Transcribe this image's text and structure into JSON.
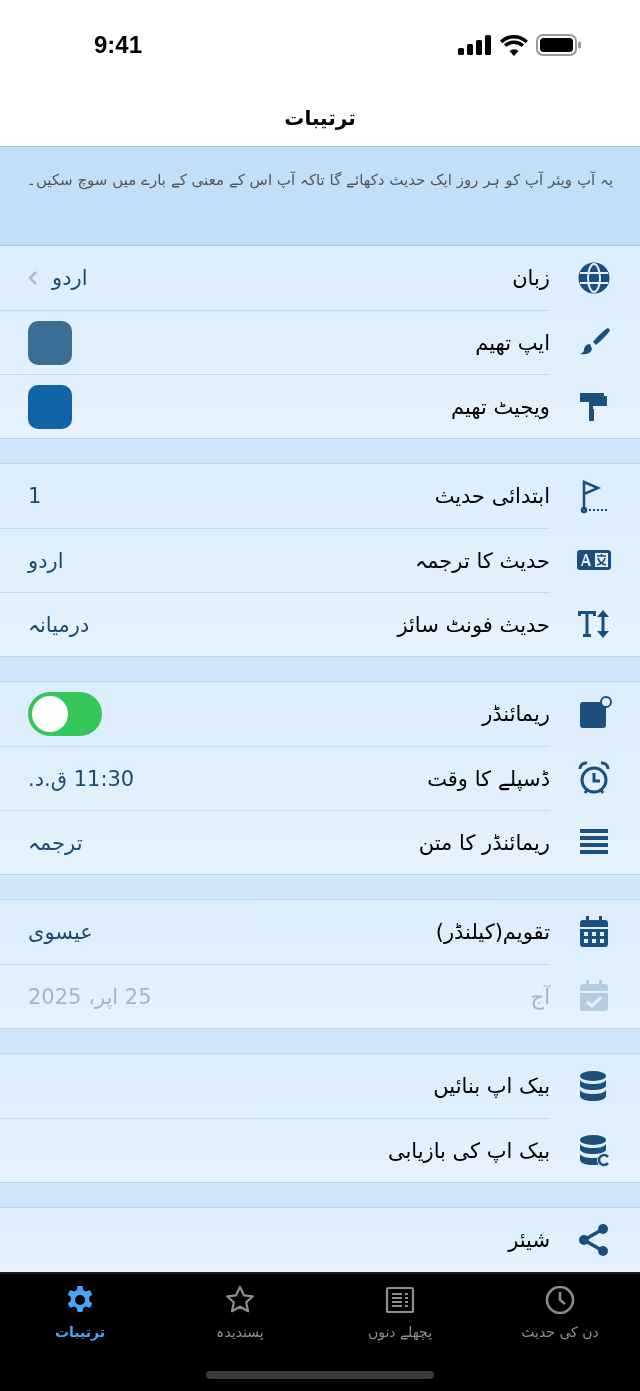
{
  "status_bar": {
    "time": "9:41"
  },
  "nav": {
    "title": "ترتیبات"
  },
  "banner": {
    "text": "یہ آپ ویئر آپ کو ہر روز ایک حدیث دکھائے گا تاکہ آپ اس کے معنی کے بارے میں سوچ سکیں۔"
  },
  "sections": [
    {
      "rows": [
        {
          "kind": "value",
          "label": "زبان",
          "value": "اردو",
          "chevron": true,
          "disabled": false
        },
        {
          "kind": "swatch",
          "label": "ایپ تھیم",
          "color": "#3a6e95",
          "disabled": false
        },
        {
          "kind": "swatch",
          "label": "ویجیٹ تھیم",
          "color": "#0f63a6",
          "disabled": false
        }
      ]
    },
    {
      "rows": [
        {
          "kind": "value",
          "label": "ابتدائی حدیث",
          "value": "1",
          "chevron": false,
          "disabled": false
        },
        {
          "kind": "value",
          "label": "حدیث کا ترجمہ",
          "value": "اردو",
          "chevron": false,
          "disabled": false
        },
        {
          "kind": "value",
          "label": "حدیث فونٹ سائز",
          "value": "درمیانہ",
          "chevron": false,
          "disabled": false
        }
      ]
    },
    {
      "rows": [
        {
          "kind": "toggle",
          "label": "ریمائنڈر",
          "on": true,
          "disabled": false
        },
        {
          "kind": "value",
          "label": "ڈسپلے کا وقت",
          "value": "11:30 ق.د.",
          "chevron": false,
          "disabled": false
        },
        {
          "kind": "value",
          "label": "ریمائنڈر کا متن",
          "value": "ترجمہ",
          "chevron": false,
          "disabled": false
        }
      ]
    },
    {
      "rows": [
        {
          "kind": "value",
          "label": "تقویم(کیلنڈر)",
          "value": "عیسوی",
          "chevron": false,
          "disabled": false
        },
        {
          "kind": "value",
          "label": "آج",
          "value": "25 اپر، 2025",
          "chevron": false,
          "disabled": true
        }
      ]
    },
    {
      "rows": [
        {
          "kind": "plain",
          "label": "بیک اپ بنائیں",
          "disabled": false
        },
        {
          "kind": "plain",
          "label": "بیک اپ کی بازیابی",
          "disabled": false
        }
      ]
    },
    {
      "rows": [
        {
          "kind": "plain",
          "label": "شیئر",
          "disabled": false
        }
      ]
    }
  ],
  "tab_bar": [
    {
      "label": "دن کی حدیث",
      "selected": false
    },
    {
      "label": "پچھلے دنوں",
      "selected": false
    },
    {
      "label": "پسندیدہ",
      "selected": false
    },
    {
      "label": "ترتیبات",
      "selected": true
    }
  ]
}
